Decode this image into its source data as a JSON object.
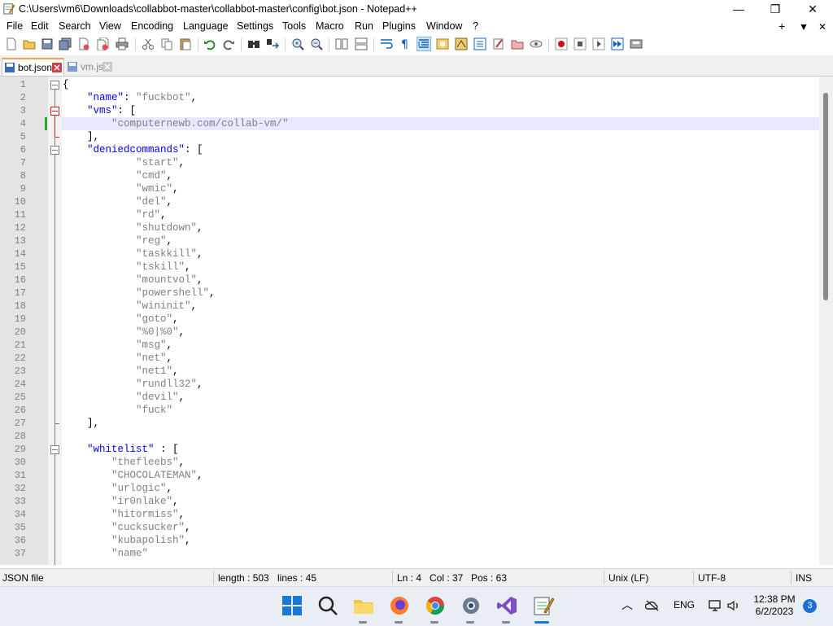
{
  "window": {
    "title": "C:\\Users\\vm6\\Downloads\\collabbot-master\\collabbot-master\\config\\bot.json - Notepad++",
    "minimize": "—",
    "maximize": "❐",
    "close": "✕"
  },
  "menu": {
    "items": [
      "File",
      "Edit",
      "Search",
      "View",
      "Encoding",
      "Language",
      "Settings",
      "Tools",
      "Macro",
      "Run",
      "Plugins",
      "Window",
      "?"
    ],
    "right_plus": "+",
    "right_down": "▼",
    "right_close": "✕"
  },
  "tabs": [
    {
      "label": "bot.json",
      "active": true
    },
    {
      "label": "vm.js",
      "active": false
    }
  ],
  "editor": {
    "current_line": 4,
    "lines": [
      {
        "n": "1",
        "parts": [
          [
            "p",
            "{"
          ]
        ]
      },
      {
        "n": "2",
        "parts": [
          [
            "p",
            "    "
          ],
          [
            "k",
            "\"name\""
          ],
          [
            "p",
            ": "
          ],
          [
            "s",
            "\"fuckbot\""
          ],
          [
            "p",
            ","
          ]
        ]
      },
      {
        "n": "3",
        "parts": [
          [
            "p",
            "    "
          ],
          [
            "k",
            "\"vms\""
          ],
          [
            "p",
            ": ["
          ]
        ]
      },
      {
        "n": "4",
        "parts": [
          [
            "p",
            "        "
          ],
          [
            "s",
            "\"computernewb.com/collab-vm/\""
          ]
        ]
      },
      {
        "n": "5",
        "parts": [
          [
            "p",
            "    ],"
          ]
        ]
      },
      {
        "n": "6",
        "parts": [
          [
            "p",
            "    "
          ],
          [
            "k",
            "\"deniedcommands\""
          ],
          [
            "p",
            ": ["
          ]
        ]
      },
      {
        "n": "7",
        "parts": [
          [
            "p",
            "            "
          ],
          [
            "s",
            "\"start\""
          ],
          [
            "p",
            ","
          ]
        ]
      },
      {
        "n": "8",
        "parts": [
          [
            "p",
            "            "
          ],
          [
            "s",
            "\"cmd\""
          ],
          [
            "p",
            ","
          ]
        ]
      },
      {
        "n": "9",
        "parts": [
          [
            "p",
            "            "
          ],
          [
            "s",
            "\"wmic\""
          ],
          [
            "p",
            ","
          ]
        ]
      },
      {
        "n": "10",
        "parts": [
          [
            "p",
            "            "
          ],
          [
            "s",
            "\"del\""
          ],
          [
            "p",
            ","
          ]
        ]
      },
      {
        "n": "11",
        "parts": [
          [
            "p",
            "            "
          ],
          [
            "s",
            "\"rd\""
          ],
          [
            "p",
            ","
          ]
        ]
      },
      {
        "n": "12",
        "parts": [
          [
            "p",
            "            "
          ],
          [
            "s",
            "\"shutdown\""
          ],
          [
            "p",
            ","
          ]
        ]
      },
      {
        "n": "13",
        "parts": [
          [
            "p",
            "            "
          ],
          [
            "s",
            "\"reg\""
          ],
          [
            "p",
            ","
          ]
        ]
      },
      {
        "n": "14",
        "parts": [
          [
            "p",
            "            "
          ],
          [
            "s",
            "\"taskkill\""
          ],
          [
            "p",
            ","
          ]
        ]
      },
      {
        "n": "15",
        "parts": [
          [
            "p",
            "            "
          ],
          [
            "s",
            "\"tskill\""
          ],
          [
            "p",
            ","
          ]
        ]
      },
      {
        "n": "16",
        "parts": [
          [
            "p",
            "            "
          ],
          [
            "s",
            "\"mountvol\""
          ],
          [
            "p",
            ","
          ]
        ]
      },
      {
        "n": "17",
        "parts": [
          [
            "p",
            "            "
          ],
          [
            "s",
            "\"powershell\""
          ],
          [
            "p",
            ","
          ]
        ]
      },
      {
        "n": "18",
        "parts": [
          [
            "p",
            "            "
          ],
          [
            "s",
            "\"wininit\""
          ],
          [
            "p",
            ","
          ]
        ]
      },
      {
        "n": "19",
        "parts": [
          [
            "p",
            "            "
          ],
          [
            "s",
            "\"goto\""
          ],
          [
            "p",
            ","
          ]
        ]
      },
      {
        "n": "20",
        "parts": [
          [
            "p",
            "            "
          ],
          [
            "s",
            "\"%0|%0\""
          ],
          [
            "p",
            ","
          ]
        ]
      },
      {
        "n": "21",
        "parts": [
          [
            "p",
            "            "
          ],
          [
            "s",
            "\"msg\""
          ],
          [
            "p",
            ","
          ]
        ]
      },
      {
        "n": "22",
        "parts": [
          [
            "p",
            "            "
          ],
          [
            "s",
            "\"net\""
          ],
          [
            "p",
            ","
          ]
        ]
      },
      {
        "n": "23",
        "parts": [
          [
            "p",
            "            "
          ],
          [
            "s",
            "\"net1\""
          ],
          [
            "p",
            ","
          ]
        ]
      },
      {
        "n": "24",
        "parts": [
          [
            "p",
            "            "
          ],
          [
            "s",
            "\"rundll32\""
          ],
          [
            "p",
            ","
          ]
        ]
      },
      {
        "n": "25",
        "parts": [
          [
            "p",
            "            "
          ],
          [
            "s",
            "\"devil\""
          ],
          [
            "p",
            ","
          ]
        ]
      },
      {
        "n": "26",
        "parts": [
          [
            "p",
            "            "
          ],
          [
            "s",
            "\"fuck\""
          ]
        ]
      },
      {
        "n": "27",
        "parts": [
          [
            "p",
            "    ],"
          ]
        ]
      },
      {
        "n": "28",
        "parts": [
          [
            "p",
            ""
          ]
        ]
      },
      {
        "n": "29",
        "parts": [
          [
            "p",
            "    "
          ],
          [
            "k",
            "\"whitelist\""
          ],
          [
            "p",
            " : ["
          ]
        ]
      },
      {
        "n": "30",
        "parts": [
          [
            "p",
            "        "
          ],
          [
            "s",
            "\"thefleebs\""
          ],
          [
            "p",
            ","
          ]
        ]
      },
      {
        "n": "31",
        "parts": [
          [
            "p",
            "        "
          ],
          [
            "s",
            "\"CHOCOLATEMAN\""
          ],
          [
            "p",
            ","
          ]
        ]
      },
      {
        "n": "32",
        "parts": [
          [
            "p",
            "        "
          ],
          [
            "s",
            "\"urlogic\""
          ],
          [
            "p",
            ","
          ]
        ]
      },
      {
        "n": "33",
        "parts": [
          [
            "p",
            "        "
          ],
          [
            "s",
            "\"ir0nlake\""
          ],
          [
            "p",
            ","
          ]
        ]
      },
      {
        "n": "34",
        "parts": [
          [
            "p",
            "        "
          ],
          [
            "s",
            "\"hitormiss\""
          ],
          [
            "p",
            ","
          ]
        ]
      },
      {
        "n": "35",
        "parts": [
          [
            "p",
            "        "
          ],
          [
            "s",
            "\"cucksucker\""
          ],
          [
            "p",
            ","
          ]
        ]
      },
      {
        "n": "36",
        "parts": [
          [
            "p",
            "        "
          ],
          [
            "s",
            "\"kubapolish\""
          ],
          [
            "p",
            ","
          ]
        ]
      },
      {
        "n": "37",
        "parts": [
          [
            "p",
            "        "
          ],
          [
            "s",
            "\"name\""
          ]
        ]
      }
    ]
  },
  "status": {
    "filetype": "JSON file",
    "length": "length : 503",
    "lines": "lines : 45",
    "ln": "Ln : 4",
    "col": "Col : 37",
    "pos": "Pos : 63",
    "eol": "Unix (LF)",
    "encoding": "UTF-8",
    "mode": "INS"
  },
  "taskbar": {
    "language": "ENG",
    "time": "12:38 PM",
    "date": "6/2/2023",
    "notifications": "3"
  },
  "colors": {
    "keyword": "#0000ff",
    "string": "#808080",
    "current_line": "#e8e8ff",
    "tab_accent": "#f6a35a"
  }
}
